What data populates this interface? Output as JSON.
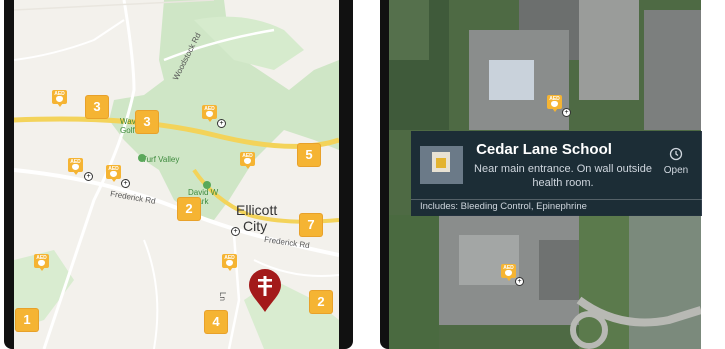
{
  "left_map": {
    "roads": [
      "Woodstock Rd",
      "Frederick Rd",
      "Frederick Rd"
    ],
    "places": {
      "city_line1": "Ellicott",
      "city_line2": "City",
      "golf_line1": "Waver",
      "golf_line2": "Golf",
      "valley": "Turf Valley",
      "park_line1": "David W",
      "park_line2": "Park"
    },
    "side_road": "Ln",
    "clusters": [
      "3",
      "3",
      "5",
      "2",
      "7",
      "4",
      "2",
      "1"
    ],
    "aed_label": "AED",
    "pin_icon": "cross-pin-icon",
    "accent_color": "#f5b433",
    "pin_color": "#a31a1a"
  },
  "right_map": {
    "callout": {
      "title": "Cedar Lane School",
      "description": "Near main entrance. On wall outside health room.",
      "hours_label": "Open",
      "includes": "Includes: Bleeding Control, Epinephrine"
    },
    "aed_label": "AED"
  }
}
